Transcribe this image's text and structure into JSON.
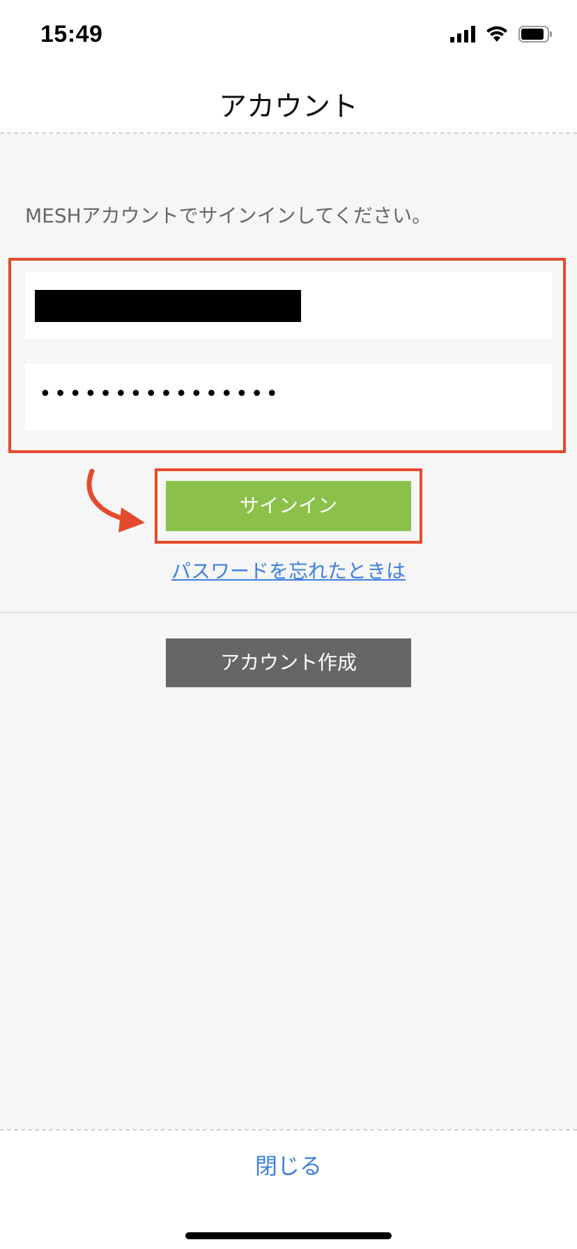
{
  "status_bar": {
    "time": "15:49",
    "icons": [
      "signal-icon",
      "wifi-icon",
      "battery-icon"
    ]
  },
  "nav": {
    "title": "アカウント"
  },
  "form": {
    "instruction": "MESHアカウントでサインインしてください。",
    "email": {
      "value": "",
      "redacted": true
    },
    "password": {
      "value": "••••••••••••••••"
    }
  },
  "buttons": {
    "signin": "サインイン",
    "forgot_password": "パスワードを忘れたときは",
    "create_account": "アカウント作成"
  },
  "bottom": {
    "close": "閉じる"
  },
  "colors": {
    "accent_green": "#8bc14a",
    "highlight_red": "#e44a2c",
    "link_blue": "#3d7fe0",
    "dark_button": "#666666",
    "background": "#f6f6f6"
  }
}
